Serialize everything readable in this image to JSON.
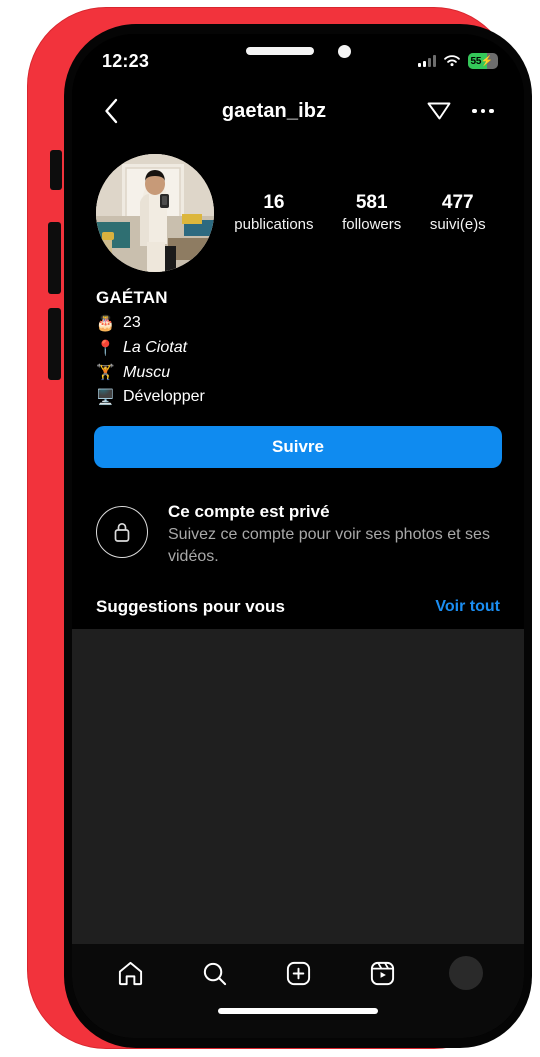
{
  "status_bar": {
    "time": "12:23",
    "battery_level": "55",
    "battery_bolt": "⚡",
    "signal_icon": "cellular-bars-icon",
    "wifi_icon": "wifi-icon",
    "battery_icon": "battery-charging-icon"
  },
  "header": {
    "back_icon": "chevron-left-icon",
    "username": "gaetan_ibz",
    "share_icon": "paper-plane-icon",
    "menu_icon": "more-options-icon"
  },
  "profile": {
    "avatar_icon": "profile-avatar",
    "stats": [
      {
        "number": "16",
        "label": "publications",
        "name": "stat-posts"
      },
      {
        "number": "581",
        "label": "followers",
        "name": "stat-followers"
      },
      {
        "number": "477",
        "label": "suivi(e)s",
        "name": "stat-following"
      }
    ],
    "display_name": "GAÉTAN",
    "bio_lines": [
      {
        "emoji": "🎂",
        "text": "23",
        "italic": false
      },
      {
        "emoji": "📍",
        "text": "La Ciotat",
        "italic": true
      },
      {
        "emoji": "🏋️",
        "text": "Muscu",
        "italic": true
      },
      {
        "emoji": "🖥️",
        "text": "Développer",
        "italic": false
      }
    ],
    "follow_button": "Suivre",
    "follow_button_color": "#0f8bf0"
  },
  "private_account": {
    "lock_icon": "lock-icon",
    "title": "Ce compte est privé",
    "subtitle": "Suivez ce compte pour voir ses photos et ses vidéos."
  },
  "suggestions": {
    "title": "Suggestions pour vous",
    "see_all": "Voir tout",
    "see_all_color": "#1b8ef2"
  },
  "tabbar": {
    "items": [
      {
        "name": "tab-home",
        "icon": "home-icon"
      },
      {
        "name": "tab-search",
        "icon": "search-icon"
      },
      {
        "name": "tab-create",
        "icon": "plus-square-icon"
      },
      {
        "name": "tab-reels",
        "icon": "reels-icon"
      },
      {
        "name": "tab-profile",
        "icon": "profile-avatar-icon"
      }
    ]
  },
  "device": {
    "frame_color": "#f2333c",
    "notch_speaker": "earpiece-speaker",
    "notch_camera": "front-camera",
    "home_indicator": "home-indicator"
  }
}
